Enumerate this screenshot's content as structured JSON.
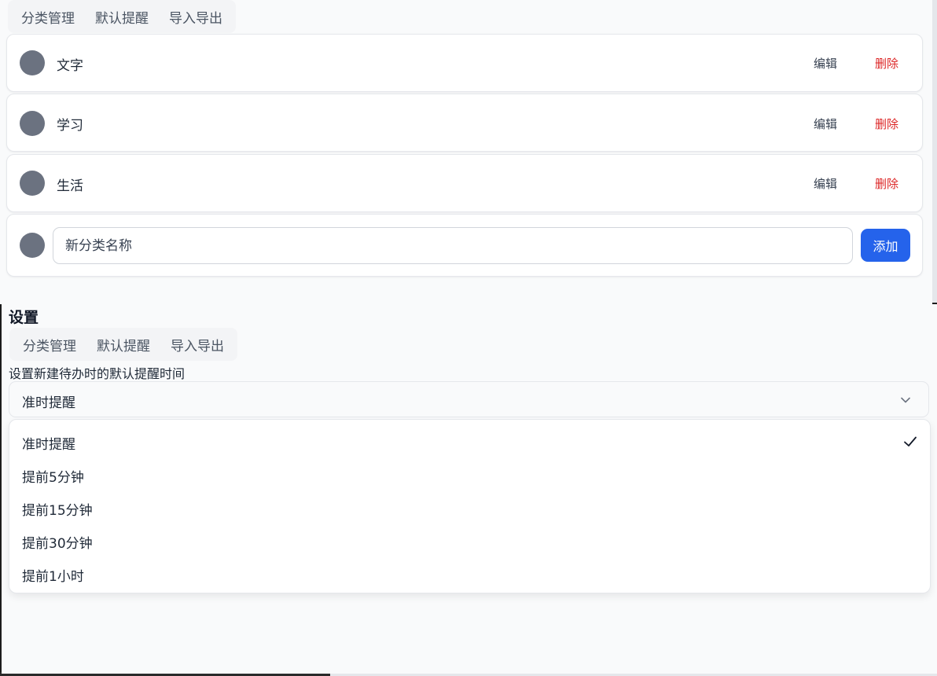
{
  "categories_panel": {
    "tabs": [
      {
        "label": "分类管理"
      },
      {
        "label": "默认提醒"
      },
      {
        "label": "导入导出"
      }
    ],
    "rows": [
      {
        "name": "文字",
        "edit_label": "编辑",
        "delete_label": "删除"
      },
      {
        "name": "学习",
        "edit_label": "编辑",
        "delete_label": "删除"
      },
      {
        "name": "生活",
        "edit_label": "编辑",
        "delete_label": "删除"
      }
    ],
    "new_category": {
      "placeholder": "新分类名称",
      "add_label": "添加"
    },
    "dot_color": "#6b7280",
    "delete_color": "#dc2626",
    "accent_color": "#2563eb"
  },
  "settings_panel": {
    "title": "设置",
    "tabs": [
      {
        "label": "分类管理"
      },
      {
        "label": "默认提醒"
      },
      {
        "label": "导入导出"
      }
    ],
    "hint": "设置新建待办时的默认提醒时间",
    "select": {
      "value": "准时提醒",
      "icon": "chevron-down-icon"
    },
    "options": [
      {
        "label": "准时提醒",
        "selected": true
      },
      {
        "label": "提前5分钟",
        "selected": false
      },
      {
        "label": "提前15分钟",
        "selected": false
      },
      {
        "label": "提前30分钟",
        "selected": false
      },
      {
        "label": "提前1小时",
        "selected": false
      }
    ]
  }
}
